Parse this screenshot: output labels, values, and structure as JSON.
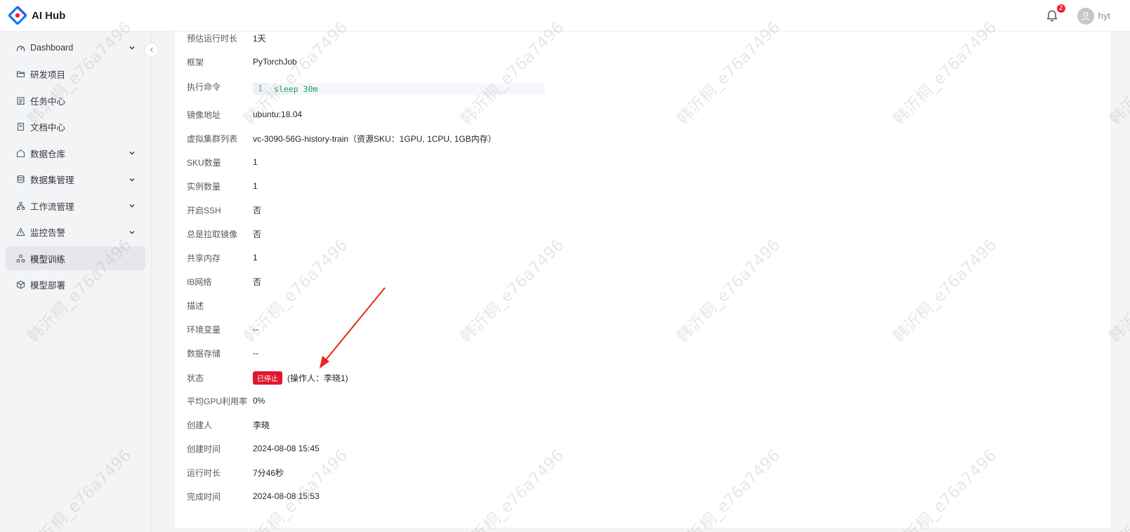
{
  "app": {
    "title": "AI Hub"
  },
  "header": {
    "notification_count": "2",
    "username": "hyt"
  },
  "sidebar": {
    "items": [
      {
        "label": "Dashboard",
        "icon": "dashboard-icon",
        "has_children": true,
        "active": false
      },
      {
        "label": "研发项目",
        "icon": "folder-icon",
        "has_children": false,
        "active": false
      },
      {
        "label": "任务中心",
        "icon": "task-icon",
        "has_children": false,
        "active": false
      },
      {
        "label": "文档中心",
        "icon": "document-icon",
        "has_children": false,
        "active": false
      },
      {
        "label": "数据仓库",
        "icon": "warehouse-icon",
        "has_children": true,
        "active": false
      },
      {
        "label": "数据集管理",
        "icon": "database-icon",
        "has_children": true,
        "active": false
      },
      {
        "label": "工作流管理",
        "icon": "workflow-icon",
        "has_children": true,
        "active": false
      },
      {
        "label": "监控告警",
        "icon": "alert-icon",
        "has_children": true,
        "active": false
      },
      {
        "label": "模型训练",
        "icon": "training-icon",
        "has_children": false,
        "active": true
      },
      {
        "label": "模型部署",
        "icon": "deploy-icon",
        "has_children": false,
        "active": false
      }
    ]
  },
  "details": {
    "duration_estimate": {
      "label": "预估运行时长",
      "value": "1天"
    },
    "framework": {
      "label": "框架",
      "value": "PyTorchJob"
    },
    "command": {
      "label": "执行命令",
      "line_no": "1",
      "code": "sleep 30m"
    },
    "image": {
      "label": "镜像地址",
      "value": "ubuntu:18.04"
    },
    "vcluster": {
      "label": "虚拟集群列表",
      "value": "vc-3090-56G-history-train（资源SKU：1GPU, 1CPU, 1GB内存）"
    },
    "sku_count": {
      "label": "SKU数量",
      "value": "1"
    },
    "instance_count": {
      "label": "实例数量",
      "value": "1"
    },
    "ssh": {
      "label": "开启SSH",
      "value": "否"
    },
    "always_pull": {
      "label": "总是拉取镜像",
      "value": "否"
    },
    "shm": {
      "label": "共享内存",
      "value": "1"
    },
    "ib": {
      "label": "IB网络",
      "value": "否"
    },
    "description": {
      "label": "描述",
      "value": ""
    },
    "env": {
      "label": "环境变量",
      "value": "--"
    },
    "storage": {
      "label": "数据存储",
      "value": "--"
    },
    "status": {
      "label": "状态",
      "tag": "已停止",
      "operator": "(操作人：李晓1)",
      "tag_color": "#e0162b"
    },
    "gpu_util": {
      "label": "平均GPU利用率",
      "value": "0%"
    },
    "creator": {
      "label": "创建人",
      "value": "李晓"
    },
    "created_at": {
      "label": "创建时间",
      "value": "2024-08-08 15:45"
    },
    "run_time": {
      "label": "运行时长",
      "value": "7分46秒"
    },
    "finished_at": {
      "label": "完成时间",
      "value": "2024-08-08 15:53"
    }
  },
  "watermark": {
    "text": "韩沂桐_e76a7496"
  },
  "colors": {
    "brand_blue": "#1677ff",
    "brand_red": "#f5222d",
    "status_red": "#e0162b",
    "code_green": "#1a9a6c",
    "arrow_red": "#e8261f"
  }
}
